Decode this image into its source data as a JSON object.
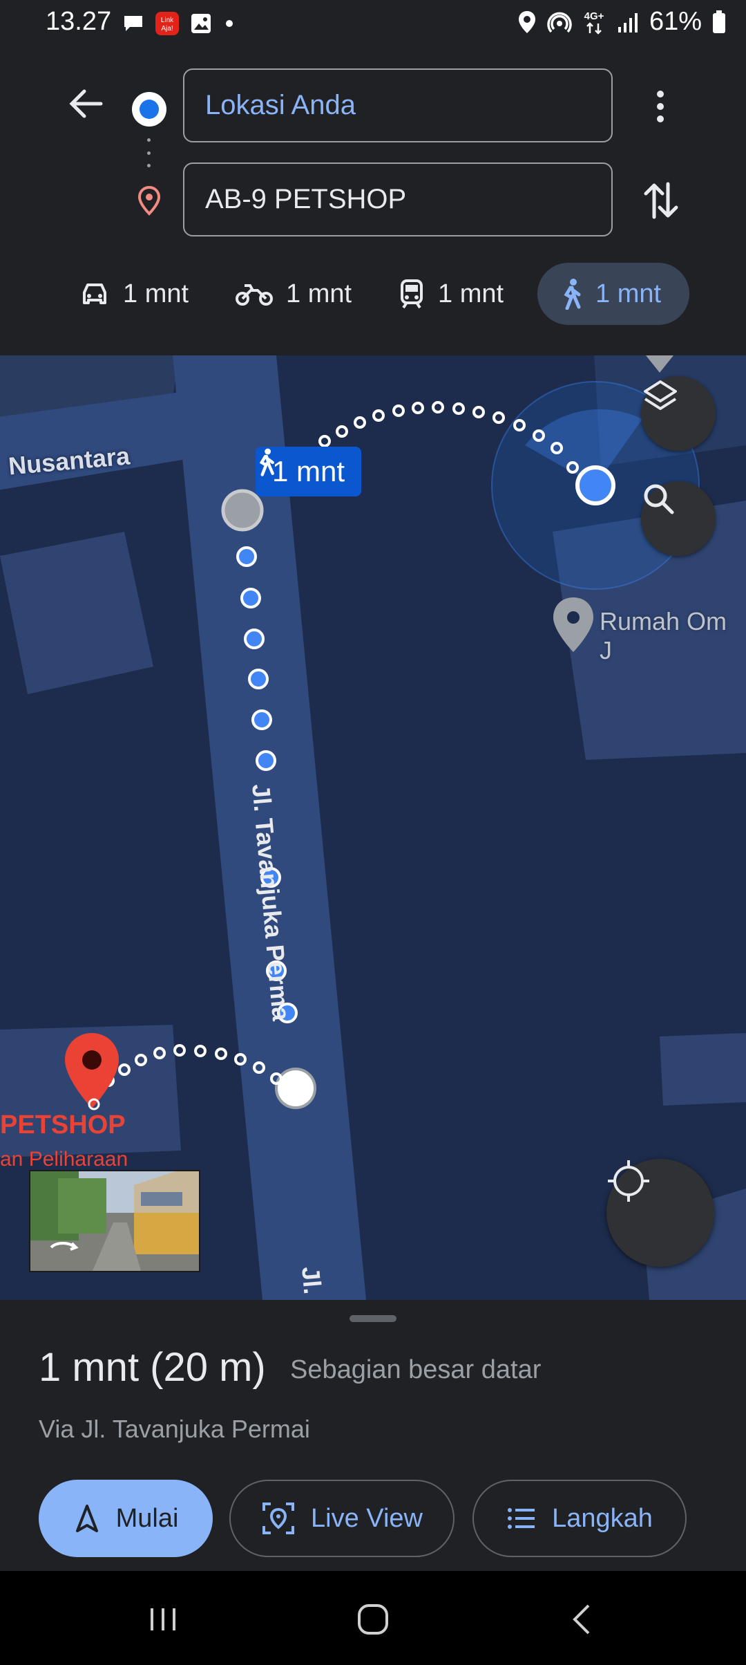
{
  "status_bar": {
    "time": "13.27",
    "left_icons": [
      "chat-bubble-icon",
      "linkaja-app-icon",
      "gallery-icon",
      "dot-icon"
    ],
    "right_icons": [
      "location-icon",
      "hotspot-icon",
      "4g-data-icon",
      "signal-bars-icon"
    ],
    "battery": "61%"
  },
  "directions": {
    "origin_value": "Lokasi Anda",
    "destination_value": "AB-9 PETSHOP"
  },
  "travel_modes": [
    {
      "mode": "driving",
      "icon": "car-icon",
      "label": "1 mnt",
      "active": false
    },
    {
      "mode": "two-wheeler",
      "icon": "motorcycle-icon",
      "label": "1 mnt",
      "active": false
    },
    {
      "mode": "transit",
      "icon": "train-icon",
      "label": "1 mnt",
      "active": false
    },
    {
      "mode": "walking",
      "icon": "walk-icon",
      "label": "1 mnt",
      "active": true
    }
  ],
  "map": {
    "street_nusantara": "Nusantara",
    "street_tavanjuka": "Jl. Tavanjuka Perma",
    "street_bottom": "Jl.",
    "route_badge": "1 mnt",
    "poi_name": "Rumah Om J",
    "destination_name": "PETSHOP",
    "destination_category": "an Peliharaan",
    "colors": {
      "map_bg": "#1d2c4d",
      "road": "#304a7d",
      "route_blue": "#4285f4",
      "badge": "#0b57d0",
      "dest_pin": "#ea4335"
    }
  },
  "summary": {
    "eta": "1 mnt (20 m)",
    "eta_sub": "Sebagian besar datar",
    "via": "Via Jl. Tavanjuka Permai"
  },
  "actions": {
    "start": "Mulai",
    "live_view": "Live View",
    "steps": "Langkah"
  },
  "nav_bar": [
    "recent-apps-icon",
    "home-icon",
    "back-icon"
  ]
}
